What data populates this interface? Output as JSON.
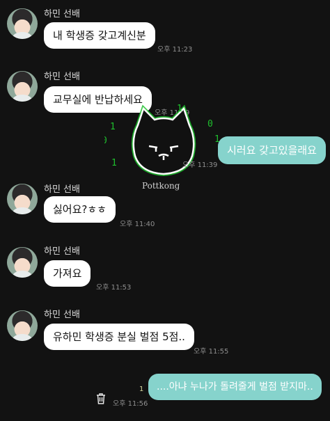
{
  "messages": [
    {
      "sender": "하민 선배",
      "text": "내 학생증 갖고계신분",
      "time": "오후 11:23"
    },
    {
      "sender": "하민 선배",
      "text": "교무실에 반납하세요",
      "time": "오후 11:39"
    },
    {
      "text": "시러요 갖고있을래요",
      "time": "오후 11:39"
    },
    {
      "sender": "하민 선배",
      "text": "싫어요?ㅎㅎ",
      "time": "오후 11:40"
    },
    {
      "sender": "하민 선배",
      "text": "가져요",
      "time": "오후 11:53"
    },
    {
      "sender": "하민 선배",
      "text": "유하민 학생증 분실 벌점 5점..",
      "time": "오후 11:55"
    },
    {
      "text": "....아냐 누나가 돌려줄게 벌점 받지마..",
      "time": "오후 11:56",
      "unread": "1"
    }
  ],
  "watermark": {
    "text": "Pottkong",
    "digits": [
      "1",
      "0",
      "1",
      "0",
      "1",
      "1",
      "0"
    ]
  },
  "colors": {
    "background": "#121212",
    "other_bubble": "#ffffff",
    "my_bubble": "#86d3cc",
    "glow": "#1fbf2e"
  },
  "icons": {
    "trash": "trash-icon",
    "avatar": "avatar"
  }
}
